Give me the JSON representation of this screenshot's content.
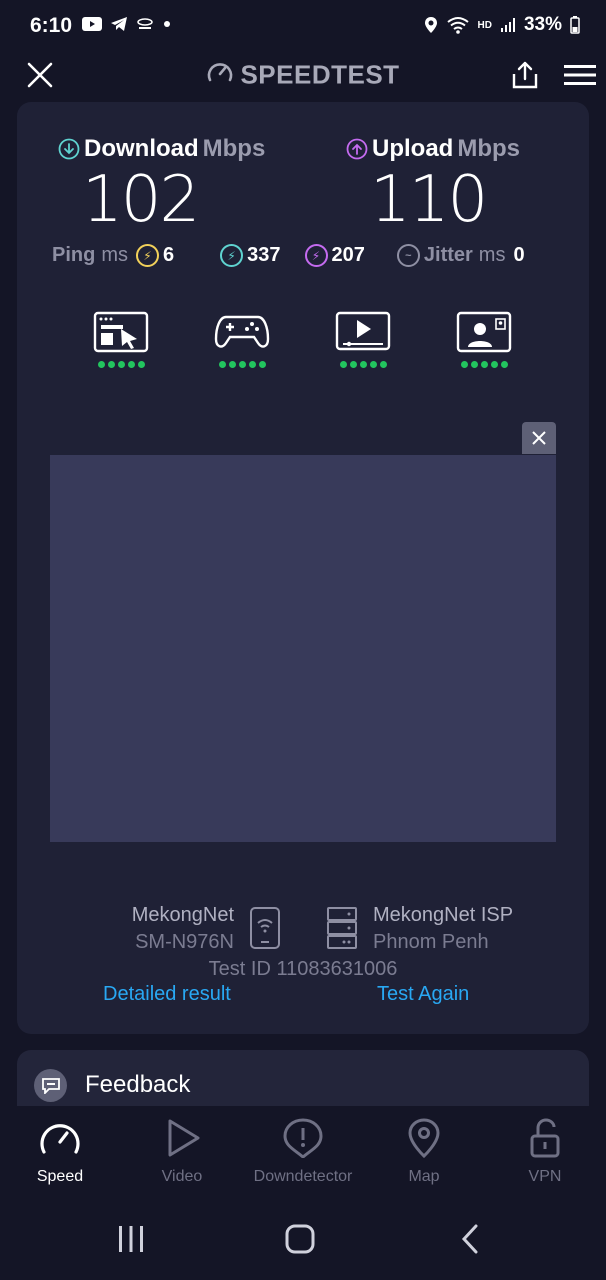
{
  "status_bar": {
    "time": "6:10",
    "battery": "33%",
    "network": "HD",
    "icons": [
      "youtube-icon",
      "telegram-icon",
      "notification-dot",
      "location-icon",
      "wifi-icon",
      "signal-icon",
      "battery-icon"
    ]
  },
  "header": {
    "title": "SPEEDTEST",
    "close_icon": "close-icon",
    "share_icon": "share-icon",
    "menu_icon": "menu-icon"
  },
  "results": {
    "download": {
      "label": "Download",
      "unit": "Mbps",
      "value": "102"
    },
    "upload": {
      "label": "Upload",
      "unit": "Mbps",
      "value": "110"
    },
    "ping": {
      "label": "Ping",
      "unit": "ms",
      "idle": "6",
      "download": "337",
      "upload": "207"
    },
    "jitter": {
      "label": "Jitter",
      "unit": "ms",
      "value": "0"
    },
    "quality_icons": [
      {
        "name": "browsing-icon",
        "rating": 5
      },
      {
        "name": "gaming-icon",
        "rating": 5
      },
      {
        "name": "video-streaming-icon",
        "rating": 5
      },
      {
        "name": "video-chat-icon",
        "rating": 5
      }
    ],
    "provider": {
      "name": "MekongNet",
      "device": "SM-N976N"
    },
    "server": {
      "name": "MekongNet ISP",
      "location": "Phnom Penh"
    },
    "test_id": "Test ID 11083631006",
    "detailed_result_label": "Detailed result",
    "test_again_label": "Test Again"
  },
  "feedback": {
    "label": "Feedback"
  },
  "bottom_nav": [
    {
      "label": "Speed",
      "icon": "speed-gauge-icon",
      "active": true
    },
    {
      "label": "Video",
      "icon": "play-icon",
      "active": false
    },
    {
      "label": "Downdetector",
      "icon": "alert-icon",
      "active": false
    },
    {
      "label": "Map",
      "icon": "map-pin-icon",
      "active": false
    },
    {
      "label": "VPN",
      "icon": "lock-open-icon",
      "active": false
    }
  ],
  "colors": {
    "background": "#141526",
    "card": "#1f2136",
    "download_accent": "#5fd3d0",
    "upload_accent": "#c46bf0",
    "idle_ping": "#f2d15a",
    "link": "#29a8f3",
    "quality_dot": "#22c55e"
  }
}
